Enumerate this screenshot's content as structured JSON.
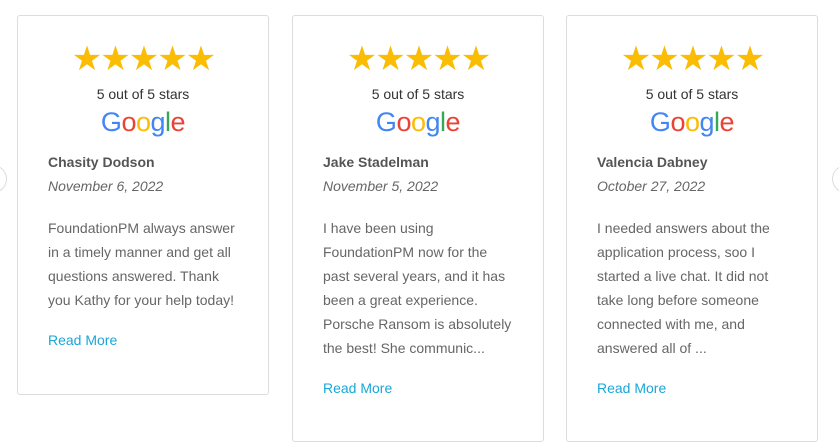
{
  "carousel": {
    "prev_label": "",
    "next_label": ""
  },
  "reviews": [
    {
      "stars": 5,
      "rating_text": "5 out of 5 stars",
      "source": "Google",
      "author": "Chasity Dodson",
      "date": "November 6, 2022",
      "text": "FoundationPM always answer in a timely manner and get all questions answered. Thank you Kathy for your help today!",
      "read_more": "Read More"
    },
    {
      "stars": 5,
      "rating_text": "5 out of 5 stars",
      "source": "Google",
      "author": "Jake Stadelman",
      "date": "November 5, 2022",
      "text": "I have been using FoundationPM now for the past several years, and it has been a great experience. Porsche Ransom is absolutely the best! She communic...",
      "read_more": "Read More"
    },
    {
      "stars": 5,
      "rating_text": "5 out of 5 stars",
      "source": "Google",
      "author": "Valencia Dabney",
      "date": "October 27, 2022",
      "text": "I needed answers about the application process, soo I started a live chat. It did not take long before someone connected with me, and answered all of ...",
      "read_more": "Read More"
    }
  ],
  "colors": {
    "star": "#fbbc04",
    "link": "#1aa7d6",
    "border": "#dcdcdc",
    "google_blue": "#4285f4",
    "google_red": "#ea4335",
    "google_yellow": "#fbbc05",
    "google_green": "#34a853"
  },
  "icons": {
    "star": "star-icon",
    "google": "google-logo",
    "prev": "chevron-left-icon",
    "next": "chevron-right-icon"
  }
}
